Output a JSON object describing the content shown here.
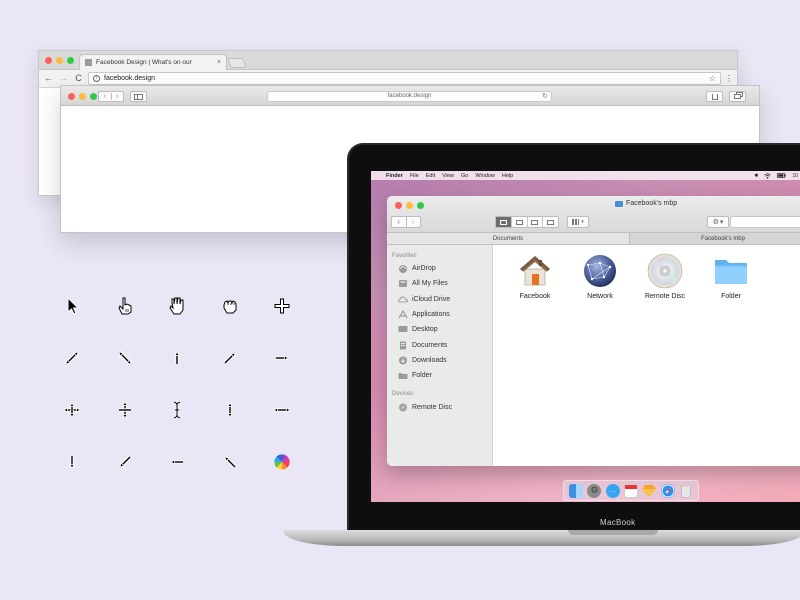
{
  "chrome": {
    "tab_title": "Facebook Design | What's on our",
    "tab_close": "×",
    "url": "facebook.design",
    "back": "←",
    "forward": "→",
    "reload": "C",
    "star": "☆",
    "menu": "⋮"
  },
  "safari": {
    "url": "facebook.design",
    "back": "‹",
    "forward": "›",
    "reload": "↻"
  },
  "cursors": [
    {
      "name": "arrow-cursor-icon"
    },
    {
      "name": "pointing-hand-cursor-icon"
    },
    {
      "name": "open-hand-cursor-icon"
    },
    {
      "name": "closed-hand-cursor-icon"
    },
    {
      "name": "crosshair-cursor-icon"
    },
    {
      "name": "resize-nesw-cursor-icon"
    },
    {
      "name": "resize-nwse-cursor-icon"
    },
    {
      "name": "resize-up-cursor-icon"
    },
    {
      "name": "resize-northeast-cursor-icon"
    },
    {
      "name": "resize-right-cursor-icon"
    },
    {
      "name": "move-cursor-icon"
    },
    {
      "name": "move-vertical-cursor-icon"
    },
    {
      "name": "text-ibeam-cursor-icon"
    },
    {
      "name": "resize-up-down-cursor-icon"
    },
    {
      "name": "resize-left-right-cursor-icon"
    },
    {
      "name": "resize-down-cursor-icon"
    },
    {
      "name": "resize-southwest-cursor-icon"
    },
    {
      "name": "resize-left-cursor-icon"
    },
    {
      "name": "resize-northwest-cursor-icon"
    },
    {
      "name": "spinning-wheel-cursor-icon"
    }
  ],
  "menubar": {
    "apple": "",
    "items": [
      "Finder",
      "File",
      "Edit",
      "View",
      "Go",
      "Window",
      "Help"
    ],
    "clock": "10"
  },
  "finder": {
    "title": "Facebook's mbp",
    "nav_back": "‹",
    "nav_forward": "›",
    "action_caret": "▾",
    "search_glass": "⚲",
    "tabs": [
      "Documents",
      "Facebook's mbp"
    ],
    "favorites_header": "Favorites",
    "favorites": [
      {
        "label": "AirDrop",
        "icon": "airdrop-icon"
      },
      {
        "label": "All My Files",
        "icon": "all-my-files-icon"
      },
      {
        "label": "iCloud Drive",
        "icon": "cloud-icon"
      },
      {
        "label": "Applications",
        "icon": "applications-icon"
      },
      {
        "label": "Desktop",
        "icon": "desktop-icon"
      },
      {
        "label": "Documents",
        "icon": "documents-icon"
      },
      {
        "label": "Downloads",
        "icon": "downloads-icon"
      },
      {
        "label": "Folder",
        "icon": "folder-icon"
      }
    ],
    "devices_header": "Devices",
    "devices": [
      {
        "label": "Remote Disc",
        "icon": "disc-icon"
      }
    ],
    "items": [
      {
        "label": "Facebook",
        "icon": "home-icon"
      },
      {
        "label": "Network",
        "icon": "network-globe-icon"
      },
      {
        "label": "Remote Disc",
        "icon": "cd-disc-icon"
      },
      {
        "label": "Folder",
        "icon": "blue-folder-icon"
      }
    ]
  },
  "dock": [
    {
      "name": "finder-dock-icon",
      "color": "#3d8fe0"
    },
    {
      "name": "system-preferences-dock-icon",
      "color": "#8a8a8a"
    },
    {
      "name": "messages-dock-icon",
      "color": "#35a7f2"
    },
    {
      "name": "calendar-dock-icon",
      "color": "#ffffff"
    },
    {
      "name": "sketch-dock-icon",
      "color": "#f5a623"
    },
    {
      "name": "safari-dock-icon",
      "color": "#2f8ff0"
    },
    {
      "name": "trash-dock-icon",
      "color": "#c9c9c9"
    }
  ],
  "macbook_label": "MacBook"
}
